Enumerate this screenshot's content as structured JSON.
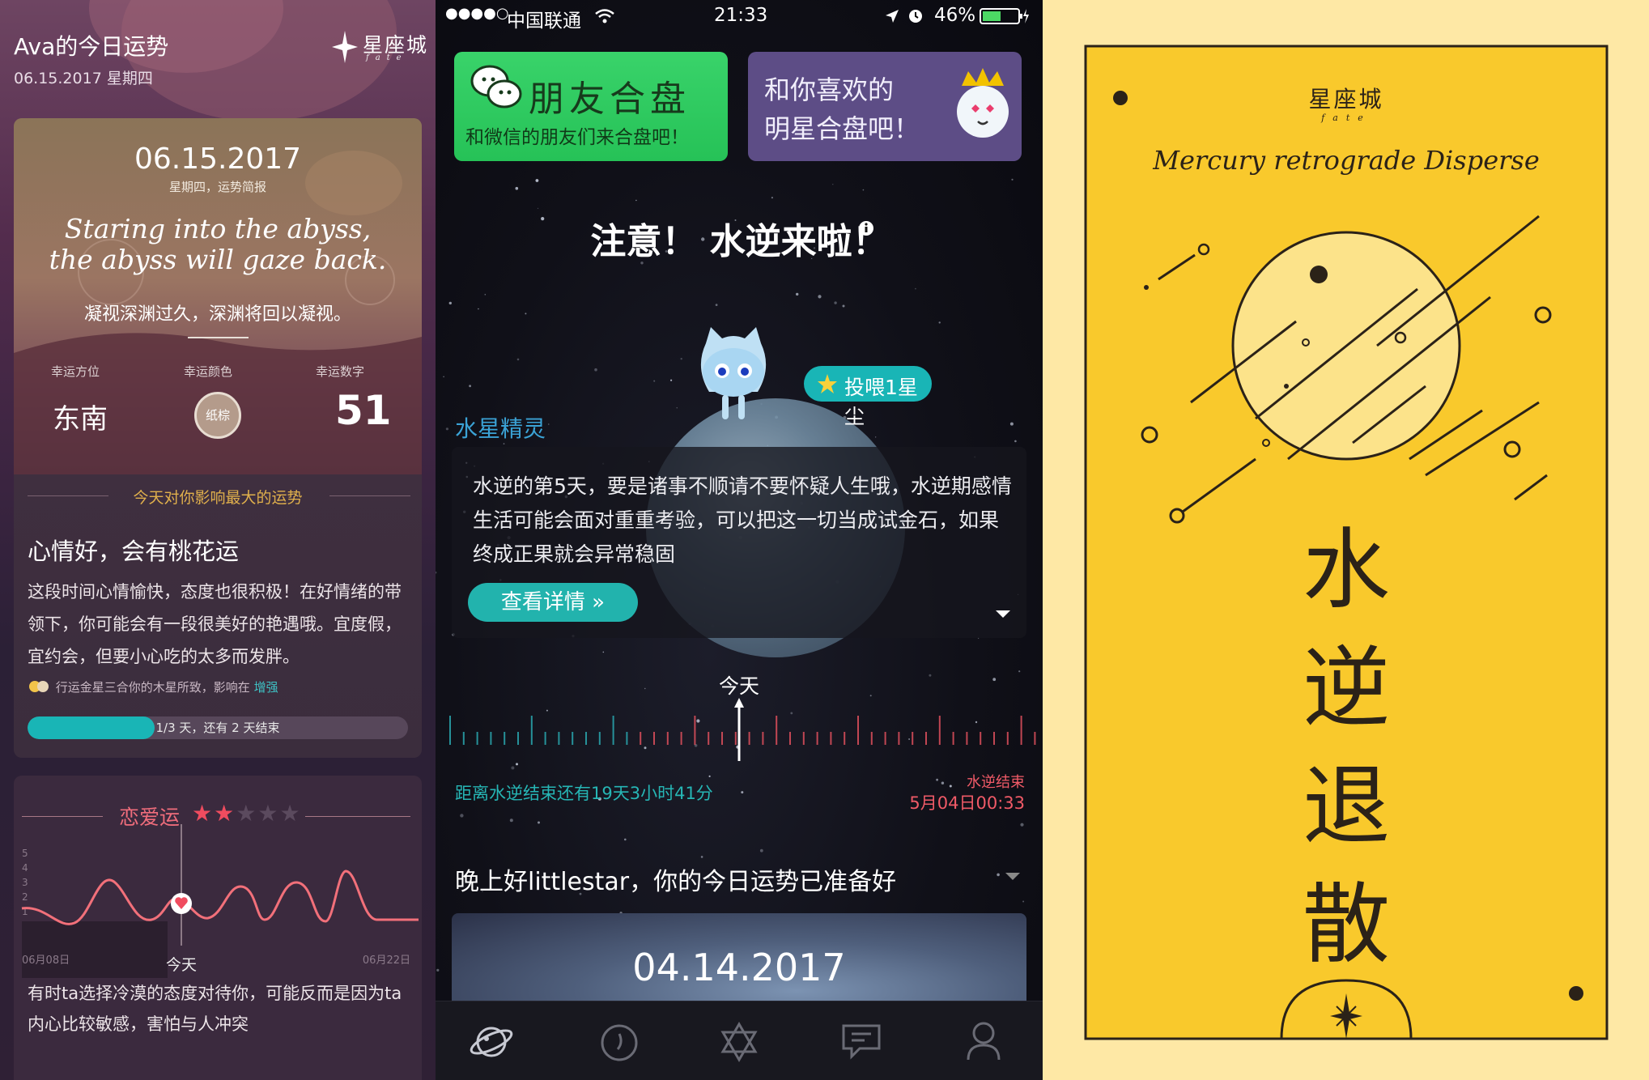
{
  "left": {
    "header": {
      "title": "Ava的今日运势",
      "date": "06.15.2017 星期四",
      "logo": "星座城",
      "logo_sub": "fate"
    },
    "card": {
      "date": "06.15.2017",
      "subtitle": "星期四，运势简报",
      "quote_en": "Staring into the abyss, the abyss will gaze back.",
      "quote_cn": "凝视深渊过久，深渊将回以凝视。",
      "lucky": {
        "direction_label": "幸运方位",
        "direction": "东南",
        "color_label": "幸运颜色",
        "color": "纸棕",
        "number_label": "幸运数字",
        "number": "51"
      },
      "section_title": "今天对你影响最大的运势",
      "mood_title": "心情好，会有桃花运",
      "mood_body": "这段时间心情愉快，态度也很积极！在好情绪的带领下，你可能会有一段很美好的艳遇哦。宜度假，宜约会，但要小心吃的太多而发胖。",
      "note_prefix": "行运金星三合你的木星所致，影响在",
      "note_highlight": "增强",
      "progress": {
        "fraction": 0.333,
        "text": "1/3 天，还有 2 天结束"
      }
    },
    "love": {
      "title": "恋爱运",
      "stars": 2,
      "stars_max": 5,
      "y_ticks": [
        "5",
        "4",
        "3",
        "2",
        "1"
      ],
      "x_start": "06月08日",
      "x_today": "今天",
      "x_end": "06月22日",
      "story": "有时ta选择冷漠的态度对待你，可能反而是因为ta内心比较敏感，害怕与人冲突"
    }
  },
  "middle": {
    "status": {
      "signal": "●●●●○",
      "carrier": "中国联通",
      "time": "21:33",
      "battery": "46%"
    },
    "banner_friends": {
      "title": "朋友合盘",
      "subtitle": "和微信的朋友们来合盘吧！"
    },
    "banner_star": {
      "line1": "和你喜欢的",
      "line2": "明星合盘吧！"
    },
    "alert": "注意！ 水逆来啦！",
    "feed_button": "投喂1星尘",
    "sprite_name": "水星精灵",
    "info_text": "水逆的第5天，要是诸事不顺请不要怀疑人生哦，水逆期感情生活可能会面对重重考验，可以把这一切当成试金石，如果终成正果就会异常稳固",
    "detail_button": "查看详情 »",
    "timeline_today": "今天",
    "countdown": "距离水逆结束还有19天3小时41分",
    "end_label": "水逆结束",
    "end_time": "5月04日00:33",
    "greeting": "晚上好littlestar，你的今日运势已准备好",
    "card_date": "04.14.2017",
    "tabs": [
      "planet-icon",
      "compass-icon",
      "hexagram-icon",
      "message-icon",
      "profile-icon"
    ]
  },
  "right": {
    "logo": "星座城",
    "logo_sub": "fate",
    "title": "Mercury retrograde Disperse",
    "chars": [
      "水",
      "逆",
      "退",
      "散"
    ]
  }
}
